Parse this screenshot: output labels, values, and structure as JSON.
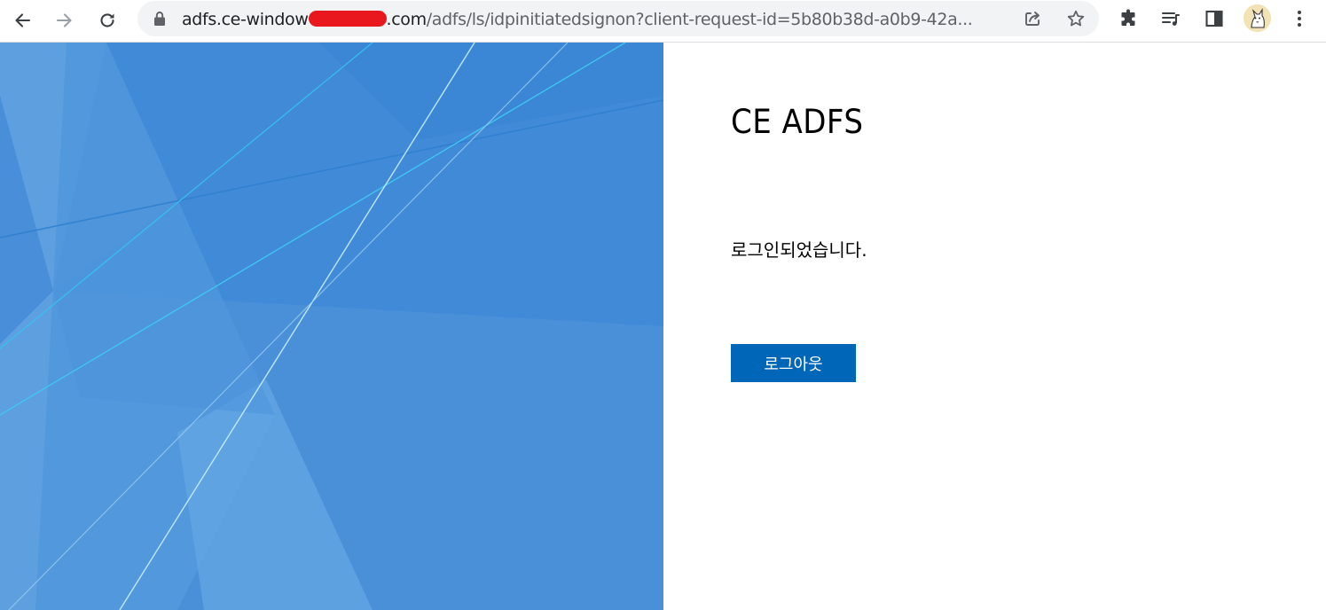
{
  "browser": {
    "url": {
      "host_start": "adfs.ce-window",
      "host_end": ".com",
      "path": "/adfs/ls/idpinitiatedsignon?client-request-id=5b80b38d-a0b9-42a..."
    },
    "icons": {
      "back": "arrow-left-icon",
      "forward": "arrow-right-icon",
      "reload": "reload-icon",
      "lock": "lock-icon",
      "share": "share-icon",
      "bookmark": "star-icon",
      "extensions": "puzzle-icon",
      "media": "media-queue-icon",
      "sidepanel": "side-panel-icon",
      "menu": "kebab-menu-icon"
    }
  },
  "page": {
    "company_name": "CE ADFS",
    "message": "로그인되었습니다.",
    "signout_label": "로그아웃"
  },
  "colors": {
    "illustration_bg": "#4a90d9",
    "button_bg": "#0067b8",
    "redaction": "#e8181e"
  }
}
